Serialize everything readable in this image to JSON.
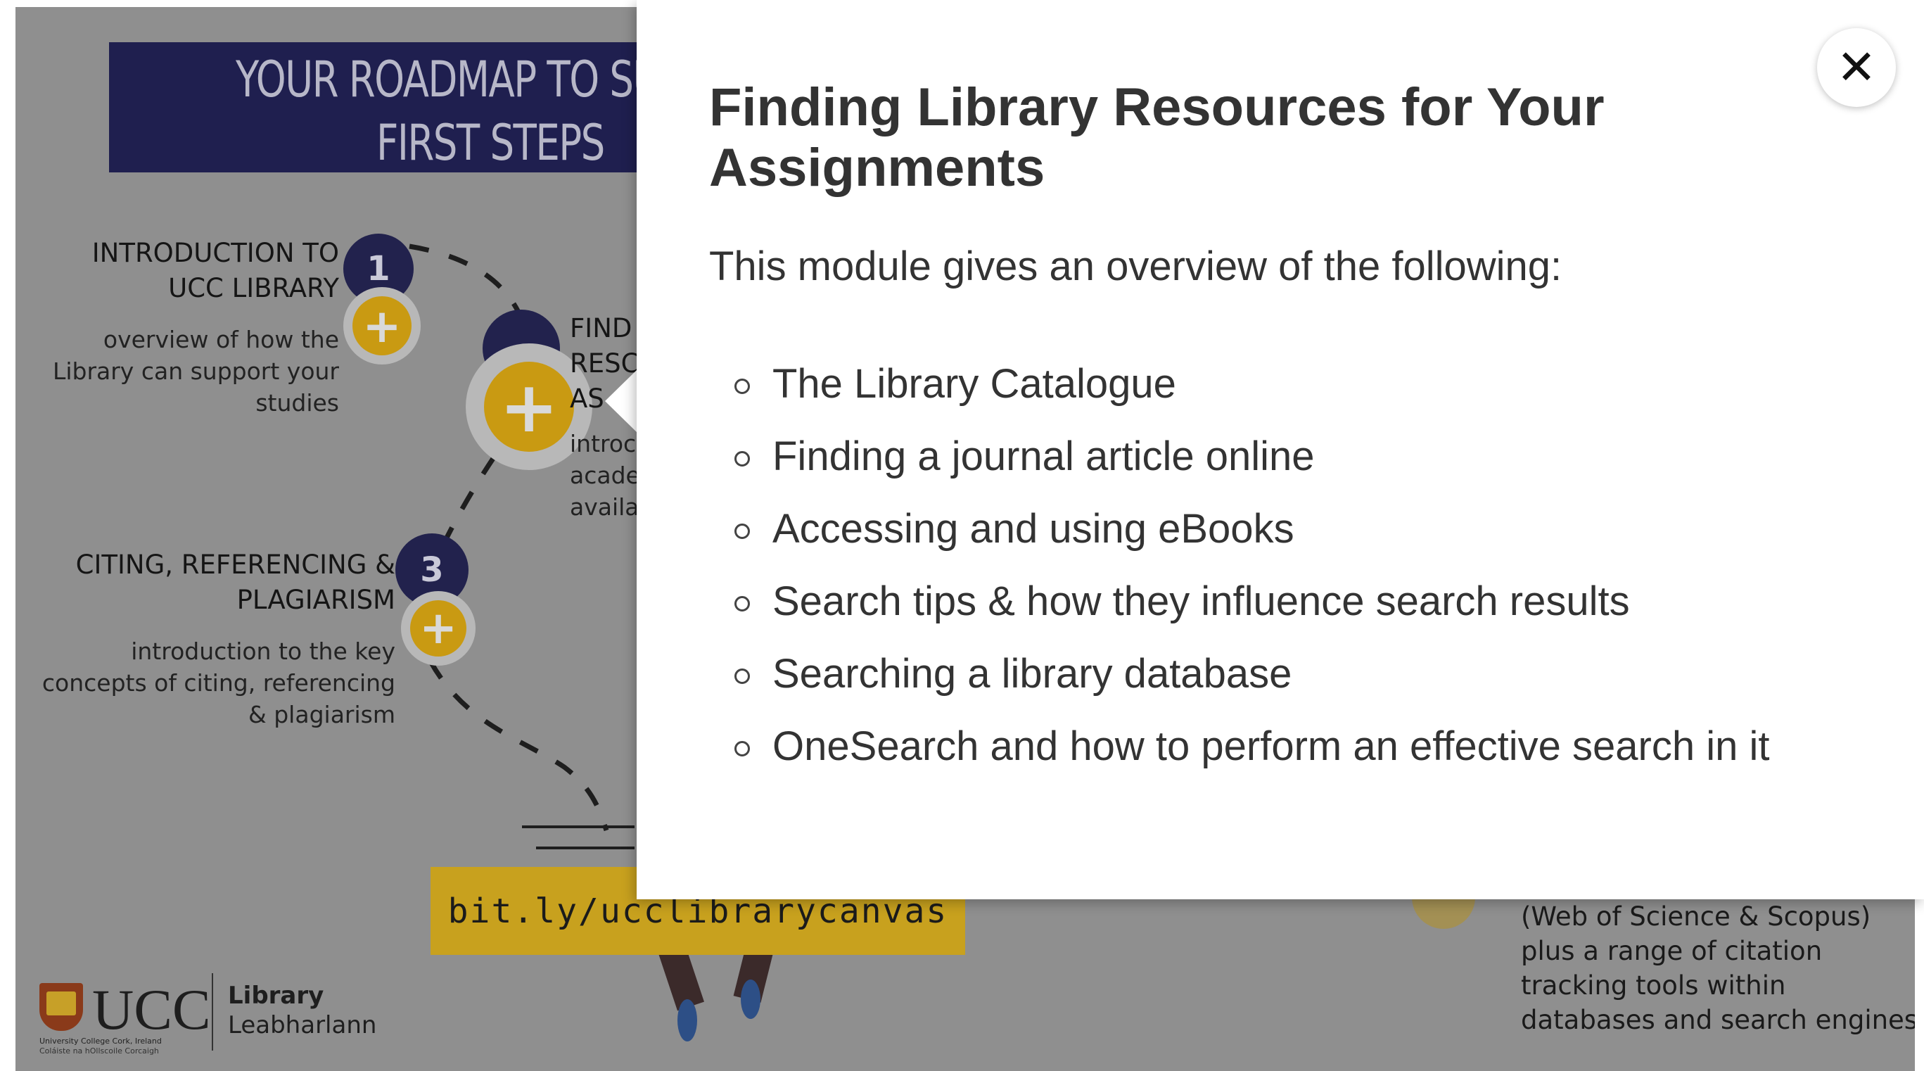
{
  "background": {
    "banner_line1": "YOUR ROADMAP TO SU",
    "banner_line2": "FIRST STEPS",
    "step1": {
      "number": "1",
      "heading_line1": "INTRODUCTION TO",
      "heading_line2": "UCC LIBRARY",
      "desc_line1": "overview of how the",
      "desc_line2": "Library can support your",
      "desc_line3": "studies"
    },
    "step2": {
      "heading_line1": "FIND",
      "heading_line2": "RESC",
      "heading_line3": "AS",
      "desc_line1": "introc",
      "desc_line2": "acade",
      "desc_line3": "availa"
    },
    "step3": {
      "number": "3",
      "heading_line1": "CITING, REFERENCING &",
      "heading_line2": "PLAGIARISM",
      "desc_line1": "introduction to the key",
      "desc_line2": "concepts of citing, referencing",
      "desc_line3": "& plagiarism"
    },
    "url": "bit.ly/ucclibrarycanvas",
    "right_text": [
      "(Web of Science & Scopus)",
      "plus a range of citation",
      "tracking tools within",
      "databases and search engines"
    ],
    "logo": {
      "name": "UCC",
      "sub1": "University College Cork, Ireland",
      "sub2": "Coláiste na hOllscoile Corcaigh",
      "library": "Library",
      "library_irish": "Leabharlann"
    },
    "plus_symbol": "+"
  },
  "modal": {
    "close_symbol": "✕",
    "title": "Finding Library Resources for Your Assignments",
    "intro": "This module gives an overview of the following:",
    "items": [
      "The Library Catalogue",
      "Finding a journal article online",
      "Accessing and using eBooks",
      "Search tips & how they influence search results",
      "Searching a library database",
      "OneSearch and how to perform an effective search in it"
    ]
  },
  "colors": {
    "overlay_bg": "#8f8f8f",
    "banner": "#1f1f4f",
    "accent_gold": "#c99a12",
    "modal_text": "#333333"
  }
}
